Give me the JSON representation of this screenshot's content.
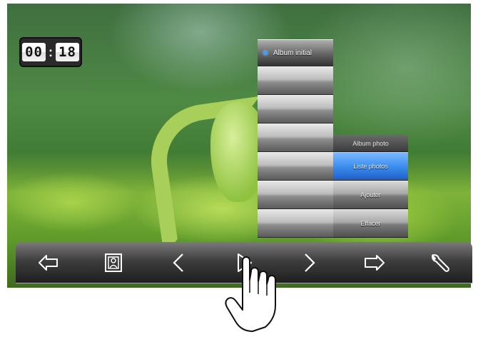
{
  "clock": {
    "minutes": "00",
    "separator": ":",
    "seconds": "18"
  },
  "menu": {
    "root": [
      {
        "label": "Album initial",
        "active": true
      },
      {
        "label": ""
      },
      {
        "label": ""
      },
      {
        "label": ""
      },
      {
        "label": ""
      },
      {
        "label": ""
      },
      {
        "label": ""
      },
      {
        "label": ""
      }
    ],
    "submenu": {
      "title": "Album photo",
      "options": [
        {
          "label": "Liste photos",
          "selected": true
        },
        {
          "label": "Ajouter"
        },
        {
          "label": "Effacer"
        }
      ]
    }
  },
  "toolbar": {
    "buttons": [
      {
        "icon": "back-icon"
      },
      {
        "icon": "contact-photo-icon"
      },
      {
        "icon": "chevron-left-icon"
      },
      {
        "icon": "play-icon"
      },
      {
        "icon": "chevron-right-icon"
      },
      {
        "icon": "forward-icon"
      },
      {
        "icon": "wrench-icon"
      }
    ]
  },
  "colors": {
    "accent": "#3d8ef0",
    "bullet": "#3aa0ff"
  }
}
